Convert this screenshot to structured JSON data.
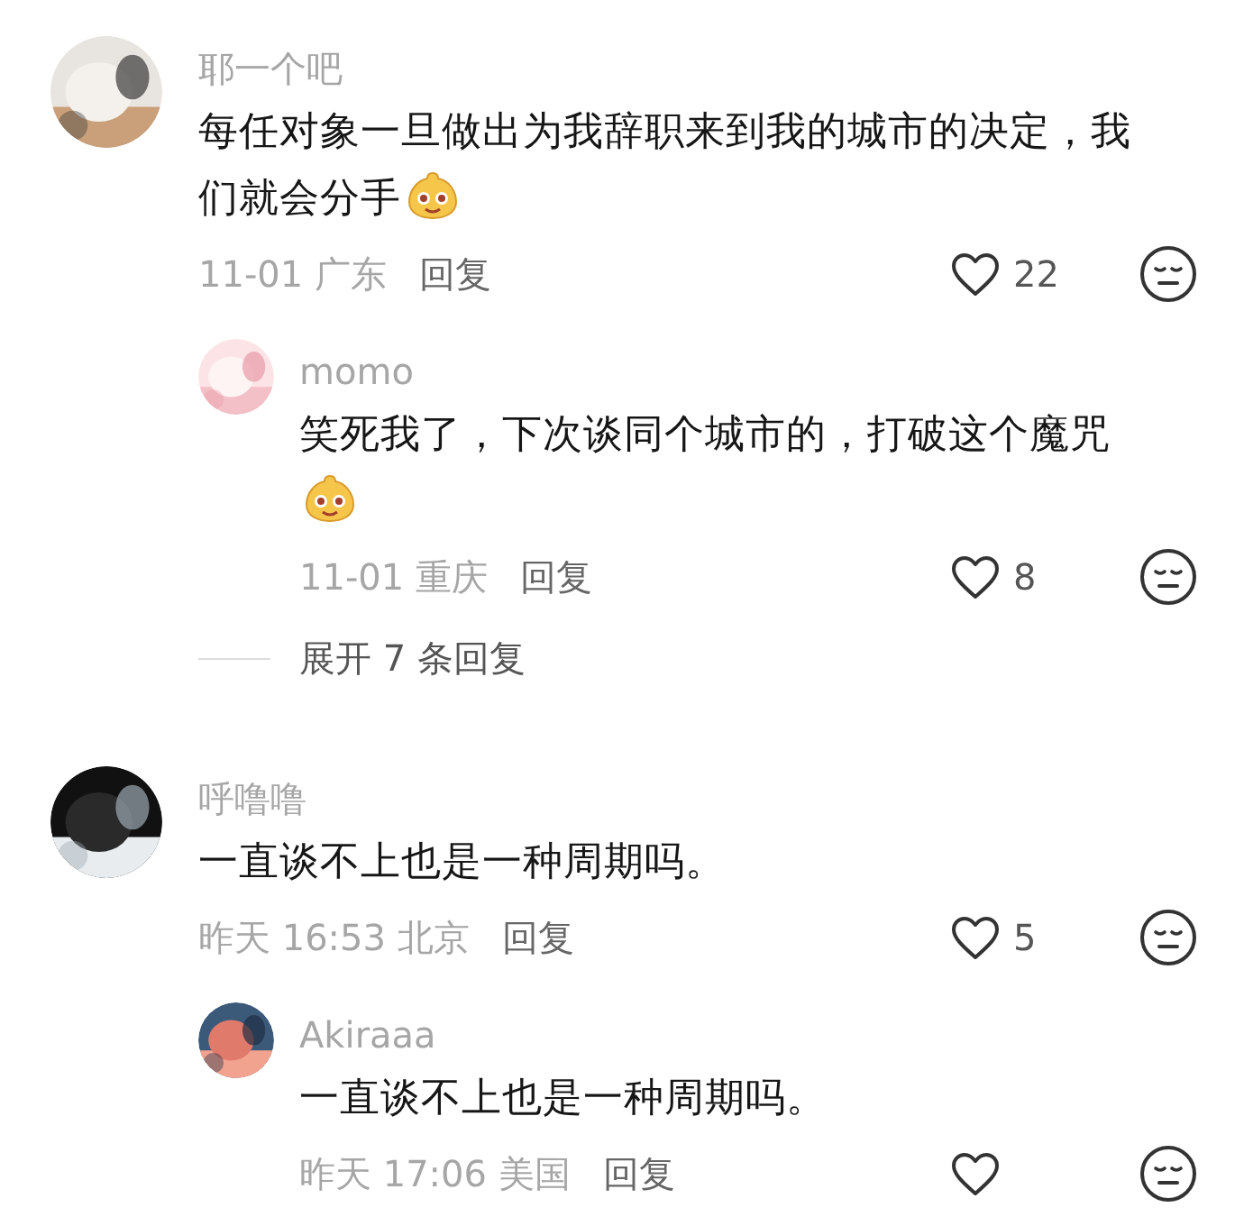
{
  "comments": [
    {
      "avatar": {
        "kind": "picture"
      },
      "name": "耶一个吧",
      "text": "每任对象一旦做出为我辞职来到我的城市的决定，我们就会分手",
      "emoji": true,
      "meta": "11-01 广东",
      "reply_label": "回复",
      "likes": "22",
      "replies": [
        {
          "avatar": {
            "kind": "picture"
          },
          "name": "momo",
          "text": "笑死我了，下次谈同个城市的，打破这个魔咒",
          "emoji": true,
          "meta": "11-01 重庆",
          "reply_label": "回复",
          "likes": "8"
        }
      ],
      "expand_label": "展开 7 条回复"
    },
    {
      "avatar": {
        "kind": "picture"
      },
      "name": "呼噜噜",
      "text": "一直谈不上也是一种周期吗。",
      "emoji": false,
      "meta": "昨天 16:53 北京",
      "reply_label": "回复",
      "likes": "5",
      "replies": [
        {
          "avatar": {
            "kind": "picture"
          },
          "name": "Akiraaa",
          "text": "一直谈不上也是一种周期吗。",
          "emoji": false,
          "meta": "昨天 17:06 美国",
          "reply_label": "回复"
        }
      ]
    }
  ]
}
